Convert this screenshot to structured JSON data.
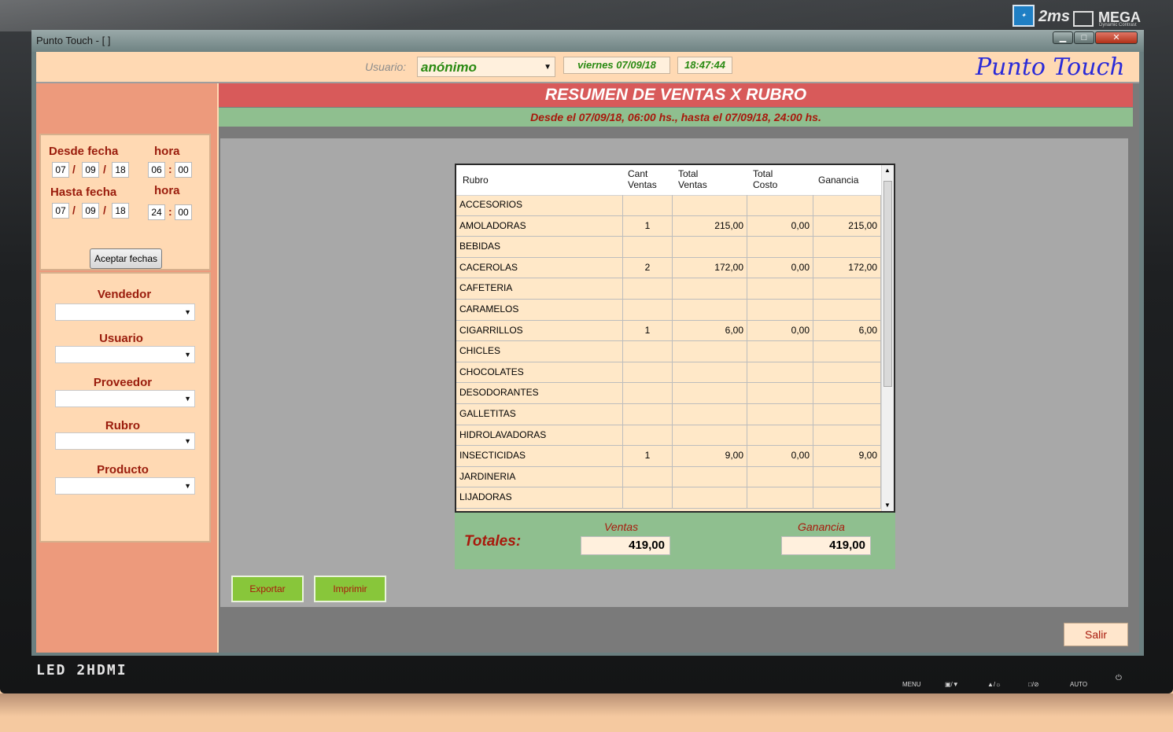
{
  "window": {
    "title": "Punto Touch - [ ]"
  },
  "monitor": {
    "brand_2ms": "2ms",
    "brand_mega": "MEGA",
    "brand_mega_sub": "Dynamic Contrast",
    "led_logo": "LED 2HDMI",
    "buttons": [
      "MENU",
      "▣/▼",
      "▲/☼",
      "□/⊘",
      "AUTO",
      "⏻"
    ]
  },
  "header": {
    "user_label": "Usuario:",
    "user_value": "anónimo",
    "date": "viernes 07/09/18",
    "time": "18:47:44",
    "brand": "Punto Touch"
  },
  "sidebar": {
    "from_label": "Desde fecha",
    "to_label": "Hasta fecha",
    "hour_label": "hora",
    "from": {
      "day": "07",
      "month": "09",
      "year": "18",
      "hour": "06",
      "minute": "00"
    },
    "to": {
      "day": "07",
      "month": "09",
      "year": "18",
      "hour": "24",
      "minute": "00"
    },
    "accept_label": "Aceptar fechas",
    "filters": [
      "Vendedor",
      "Usuario",
      "Proveedor",
      "Rubro",
      "Producto"
    ]
  },
  "report": {
    "title": "RESUMEN DE VENTAS X RUBRO",
    "range": "Desde el 07/09/18, 06:00 hs., hasta el 07/09/18, 24:00 hs.",
    "columns": [
      "Rubro",
      "Cant\nVentas",
      "Total\nVentas",
      "Total\nCosto",
      "Ganancia"
    ],
    "rows": [
      [
        "ACCESORIOS",
        "",
        "",
        "",
        ""
      ],
      [
        "AMOLADORAS",
        "1",
        "215,00",
        "0,00",
        "215,00"
      ],
      [
        "BEBIDAS",
        "",
        "",
        "",
        ""
      ],
      [
        "CACEROLAS",
        "2",
        "172,00",
        "0,00",
        "172,00"
      ],
      [
        "CAFETERIA",
        "",
        "",
        "",
        ""
      ],
      [
        "CARAMELOS",
        "",
        "",
        "",
        ""
      ],
      [
        "CIGARRILLOS",
        "1",
        "6,00",
        "0,00",
        "6,00"
      ],
      [
        "CHICLES",
        "",
        "",
        "",
        ""
      ],
      [
        "CHOCOLATES",
        "",
        "",
        "",
        ""
      ],
      [
        "DESODORANTES",
        "",
        "",
        "",
        ""
      ],
      [
        "GALLETITAS",
        "",
        "",
        "",
        ""
      ],
      [
        "HIDROLAVADORAS",
        "",
        "",
        "",
        ""
      ],
      [
        "INSECTICIDAS",
        "1",
        "9,00",
        "0,00",
        "9,00"
      ],
      [
        "JARDINERIA",
        "",
        "",
        "",
        ""
      ],
      [
        "LIJADORAS",
        "",
        "",
        "",
        ""
      ]
    ],
    "totals_label": "Totales:",
    "ventas_label": "Ventas",
    "ventas_value": "419,00",
    "ganancia_label": "Ganancia",
    "ganancia_value": "419,00",
    "export_label": "Exportar",
    "print_label": "Imprimir",
    "exit_label": "Salir"
  }
}
